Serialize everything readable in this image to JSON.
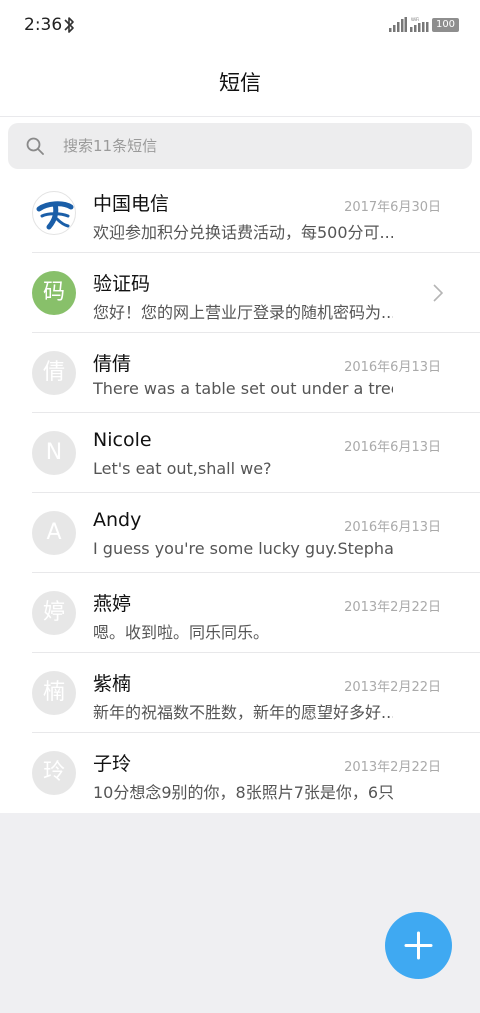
{
  "status_bar": {
    "time": "2:36",
    "wifi_label": "WiFi",
    "battery": "100"
  },
  "header": {
    "title": "短信"
  },
  "search": {
    "placeholder": "搜索11条短信"
  },
  "colors": {
    "accent": "#3fa9f2",
    "verification_avatar": "#88c06a",
    "avatar_placeholder": "#e7e7e7",
    "background": "#efeff2"
  },
  "conversations": [
    {
      "avatar": "",
      "avatar_icon": "china-telecom-logo",
      "name": "中国电信",
      "date": "2017年6月30日",
      "preview": "欢迎参加积分兑换话费活动，每500分可..."
    },
    {
      "avatar": "码",
      "name": "验证码",
      "date": "",
      "preview": "您好！您的网上营业厅登录的随机密码为..."
    },
    {
      "avatar": "倩",
      "name": "倩倩",
      "date": "2016年6月13日",
      "preview": "There was a table set out under a tree i..."
    },
    {
      "avatar": "N",
      "name": "Nicole",
      "date": "2016年6月13日",
      "preview": "Let's eat out,shall we?"
    },
    {
      "avatar": "A",
      "name": "Andy",
      "date": "2016年6月13日",
      "preview": "I guess you're some lucky guy.Stepha..."
    },
    {
      "avatar": "婷",
      "name": "燕婷",
      "date": "2013年2月22日",
      "preview": "嗯。收到啦。同乐同乐。"
    },
    {
      "avatar": "楠",
      "name": "紫楠",
      "date": "2013年2月22日",
      "preview": "新年的祝福数不胜数，新年的愿望好多好..."
    },
    {
      "avatar": "玲",
      "name": "子玲",
      "date": "2013年2月22日",
      "preview": "10分想念9别的你，8张照片7张是你，6只..."
    }
  ],
  "fab": {
    "icon": "plus-icon"
  }
}
